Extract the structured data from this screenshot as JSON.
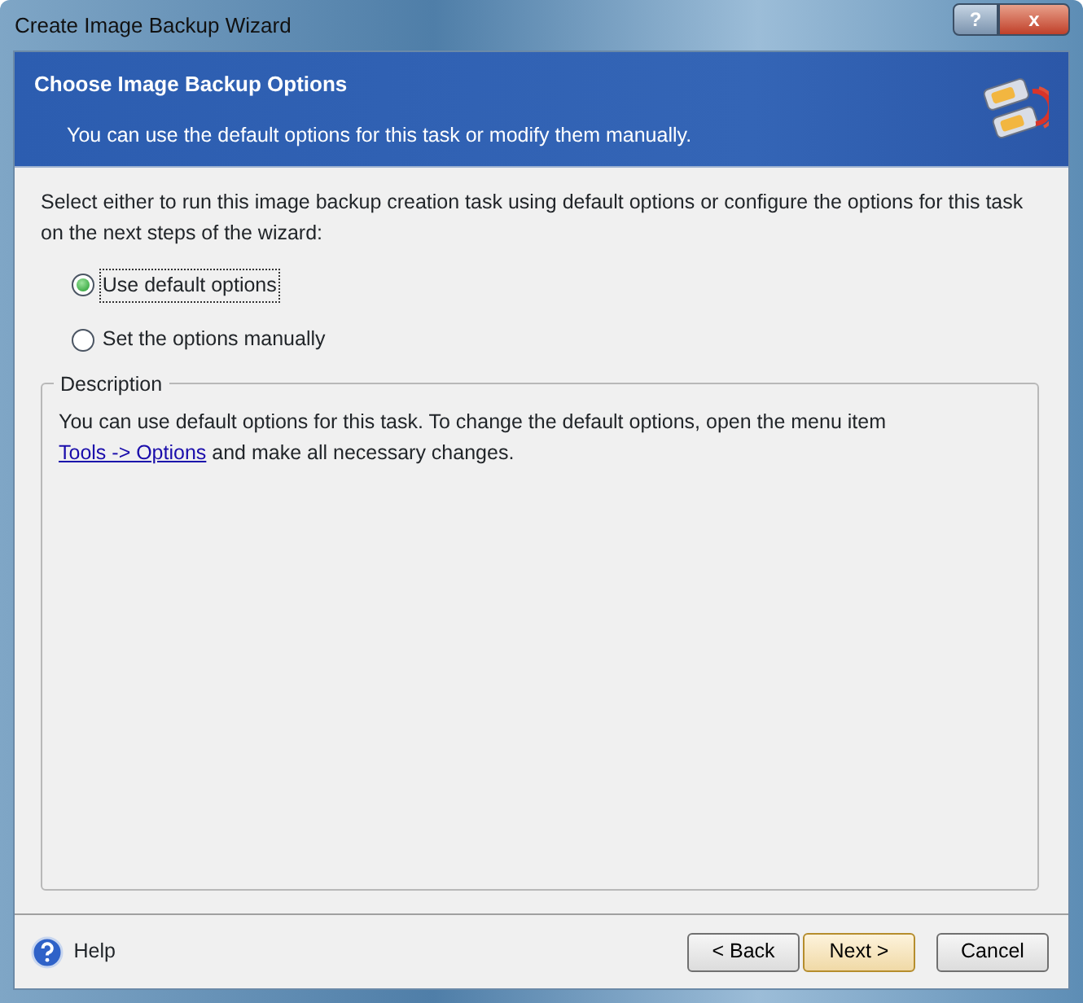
{
  "window": {
    "title": "Create Image Backup Wizard",
    "controls": [
      {
        "kind": "help",
        "label": "?"
      },
      {
        "kind": "close",
        "label": "x"
      }
    ]
  },
  "header": {
    "title": "Choose Image Backup Options",
    "subtitle": "You can use the default options for this task or modify them manually."
  },
  "intro": "Select either to run this image backup creation task using default options or configure the options for this task on the next steps of the wizard:",
  "options": [
    {
      "label": "Use default options",
      "selected": true
    },
    {
      "label": "Set the options manually",
      "selected": false
    }
  ],
  "description": {
    "legend": "Description",
    "text_before": "You can use default options for this task. To change the default options, open the menu item",
    "link": "Tools -> Options",
    "text_after": "and make all necessary changes."
  },
  "footer": {
    "help": "Help",
    "buttons": [
      {
        "label": "< Back",
        "default": false
      },
      {
        "label": "Next >",
        "default": true
      },
      {
        "label": "Cancel",
        "default": false
      }
    ]
  }
}
